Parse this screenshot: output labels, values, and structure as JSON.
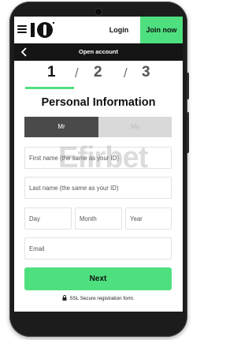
{
  "header": {
    "login_label": "Login",
    "join_label": "Join now",
    "logo_icon": "10bet-logo"
  },
  "subheader": {
    "title": "Open account",
    "back_icon": "chevron-left-icon"
  },
  "steps": {
    "items": [
      "1",
      "2",
      "3"
    ],
    "separator": "/",
    "active_index": 0
  },
  "form": {
    "title": "Personal Information",
    "salutation": {
      "options": [
        "Mr",
        "Ms"
      ],
      "selected": "Mr"
    },
    "first_name": {
      "placeholder": "First name (the same as your ID)",
      "value": ""
    },
    "last_name": {
      "placeholder": "Last name (the same as your ID)",
      "value": ""
    },
    "dob": {
      "day_placeholder": "Day",
      "month_placeholder": "Month",
      "year_placeholder": "Year"
    },
    "email": {
      "placeholder": "Email",
      "value": ""
    },
    "next_label": "Next",
    "secure_note": "SSL Secure registration form."
  },
  "watermark": "Efirbet",
  "colors": {
    "accent": "#4ee07f",
    "dark_bar": "#151515",
    "toggle_active": "#4a4a4a",
    "toggle_inactive": "#d9d9d9"
  }
}
